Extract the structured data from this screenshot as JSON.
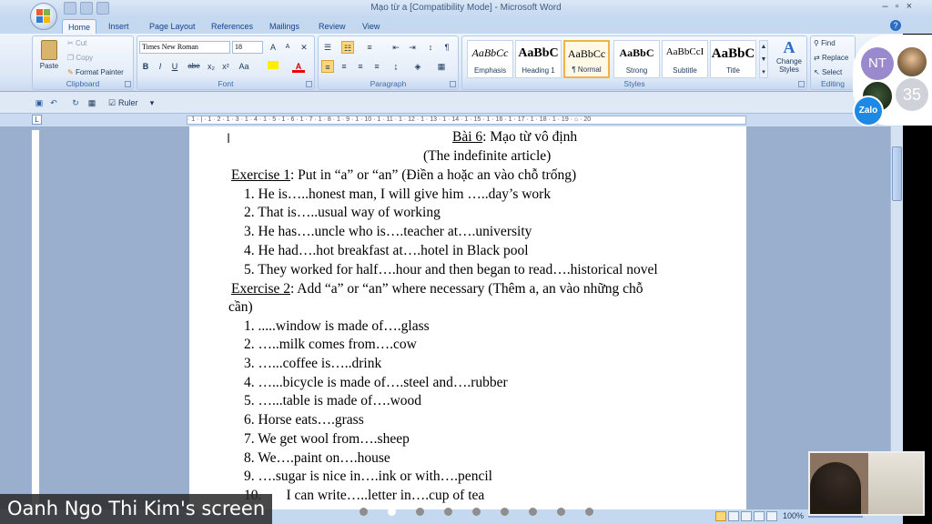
{
  "window": {
    "title": "Mạo từ a [Compatibility Mode] - Microsoft Word",
    "controls": [
      "–",
      "▫",
      "×"
    ]
  },
  "tabs": [
    "Home",
    "Insert",
    "Page Layout",
    "References",
    "Mailings",
    "Review",
    "View"
  ],
  "active_tab": "Home",
  "clipboard": {
    "paste": "Paste",
    "cut": "Cut",
    "copy": "Copy",
    "format_painter": "Format Painter",
    "label": "Clipboard"
  },
  "font": {
    "family": "Times New Roman",
    "size": "18",
    "label": "Font",
    "format_buttons": [
      "B",
      "I",
      "U",
      "abe",
      "x₂",
      "x²",
      "Aa"
    ]
  },
  "paragraph": {
    "label": "Paragraph"
  },
  "styles": {
    "label": "Styles",
    "items": [
      {
        "sample": "AaBbCc",
        "name": "Emphasis"
      },
      {
        "sample": "AaBbC",
        "name": "Heading 1"
      },
      {
        "sample": "AaBbCc",
        "name": "¶ Normal"
      },
      {
        "sample": "AaBbC",
        "name": "Strong"
      },
      {
        "sample": "AaBbCcI",
        "name": "Subtitle"
      },
      {
        "sample": "AaBbC",
        "name": "Title"
      }
    ],
    "change_styles": "Change Styles"
  },
  "editing": {
    "find": "Find",
    "replace": "Replace",
    "select": "Select",
    "label": "Editing"
  },
  "quick_toolbar": {
    "ruler_label": "Ruler"
  },
  "ruler_text": "· 1 · | · 1 · 2 · 1 · 3 · 1 · 4 · 1 · 5 · 1 · 6 · 1 · 7 · 1 · 8 · 1 · 9 · 1 · 10 · 1 · 11 · 1 · 12 · 1 · 13 · 1 · 14 · 1 · 15 · 1 · 16 · 1 · 17 · 1 · 18 · 1 · 19 · ⌂ · 20",
  "document": {
    "title_prefix": "Bài 6",
    "title_rest": ": Mạo từ vô định",
    "subtitle": "(The indefinite article)",
    "ex1_label": "Exercise 1",
    "ex1_text": ": Put in “a” or “an” (Điền a hoặc an vào chỗ trống)",
    "ex1_items": [
      "1. He is…..honest man, I will give him …..day’s work",
      "2. That is…..usual way of working",
      "3. He has….uncle who is….teacher at….university",
      "4. He had….hot breakfast at….hotel in Black pool",
      "5. They worked for half….hour and then began to read….historical novel"
    ],
    "ex2_label": "Exercise 2",
    "ex2_text": ": Add “a” or “an” where necessary (Thêm a, an vào những chỗ",
    "ex2_wrap": "cần)",
    "ex2_items": [
      "1. .....window is made of….glass",
      "2. …..milk comes from….cow",
      "3. …...coffee is…..drink",
      "4. …...bicycle is made of….steel and….rubber",
      "5. …...table is made of….wood",
      "6. Horse eats….grass",
      "7. We get wool from….sheep",
      "8. We….paint on….house",
      "9. ….sugar is nice in….ink or with….pencil",
      "10.       I can write…..letter in….cup of tea"
    ]
  },
  "status": {
    "zoom": "100%"
  },
  "participants": {
    "initials": "NT",
    "count": "35",
    "app": "Zalo"
  },
  "screen_share_label": "Oanh Ngo Thi Kim's screen"
}
